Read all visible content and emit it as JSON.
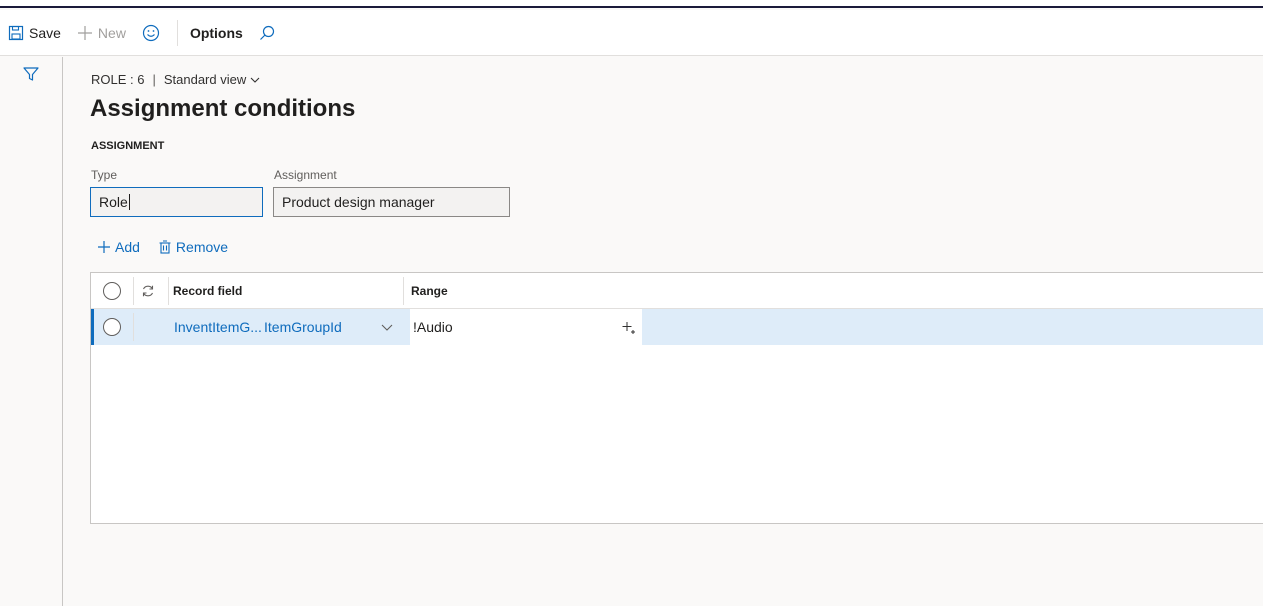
{
  "toolbar": {
    "save_label": "Save",
    "new_label": "New",
    "options_label": "Options"
  },
  "breadcrumb": {
    "record": "ROLE : 6",
    "separator": "|",
    "view": "Standard view"
  },
  "page_title": "Assignment conditions",
  "section": {
    "header": "ASSIGNMENT",
    "type_label": "Type",
    "type_value": "Role",
    "assignment_label": "Assignment",
    "assignment_value": "Product design manager"
  },
  "actions": {
    "add_label": "Add",
    "remove_label": "Remove"
  },
  "grid": {
    "columns": [
      "Record field",
      "Range"
    ],
    "rows": [
      {
        "table": "InventItemG...",
        "field": "ItemGroupId",
        "range": "!Audio"
      }
    ]
  },
  "colors": {
    "accent": "#0f6cbd",
    "selected_row": "#deecf9"
  }
}
